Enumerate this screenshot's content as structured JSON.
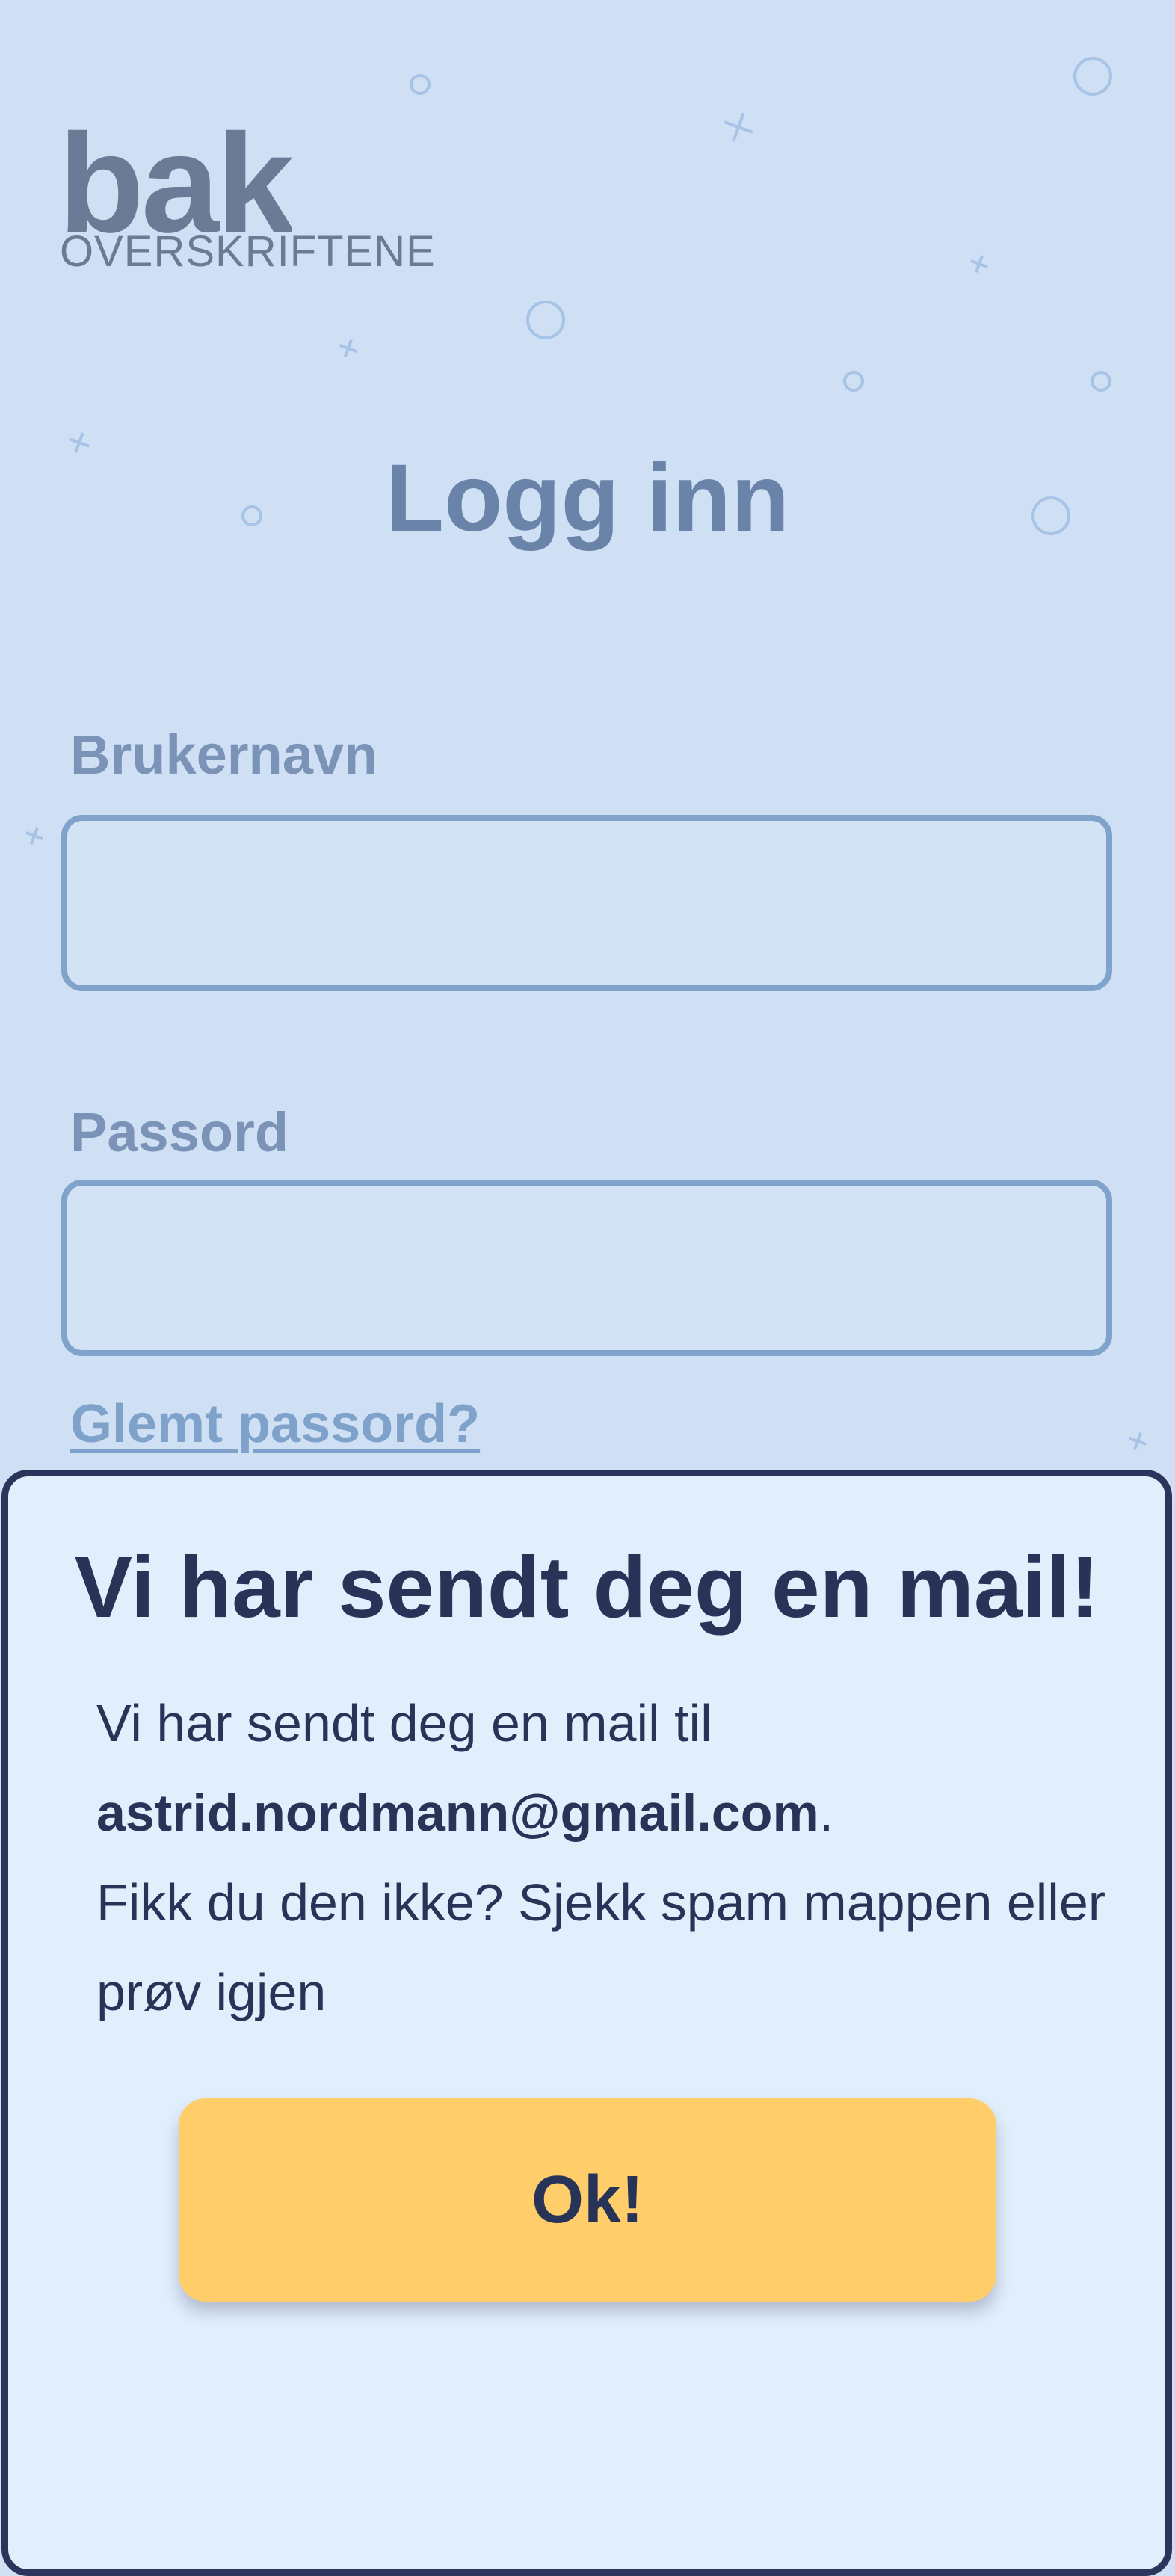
{
  "logo": {
    "word": "bak",
    "subtitle": "OVERSKRIFTENE"
  },
  "login": {
    "title": "Logg inn",
    "username_label": "Brukernavn",
    "username_value": "",
    "password_label": "Passord",
    "password_value": "",
    "forgot_link": "Glemt passord?"
  },
  "modal": {
    "title": "Vi har sendt deg en mail!",
    "body_intro": "Vi har sendt deg en mail til",
    "email": "astrid.nordmann@gmail.com",
    "email_suffix": ".",
    "body_followup": "Fikk du den ikke? Sjekk spam mappen eller prøv igjen",
    "ok_label": "Ok!"
  },
  "colors": {
    "background": "#cfe0f5",
    "modal_background": "#e1eefc",
    "modal_border": "#2b355c",
    "button": "#ffcd6a",
    "text_dark": "#283358",
    "input_border": "#7fa3cb",
    "label": "#7b93b6"
  },
  "icons": [
    "circle-decoration",
    "cross-decoration"
  ]
}
